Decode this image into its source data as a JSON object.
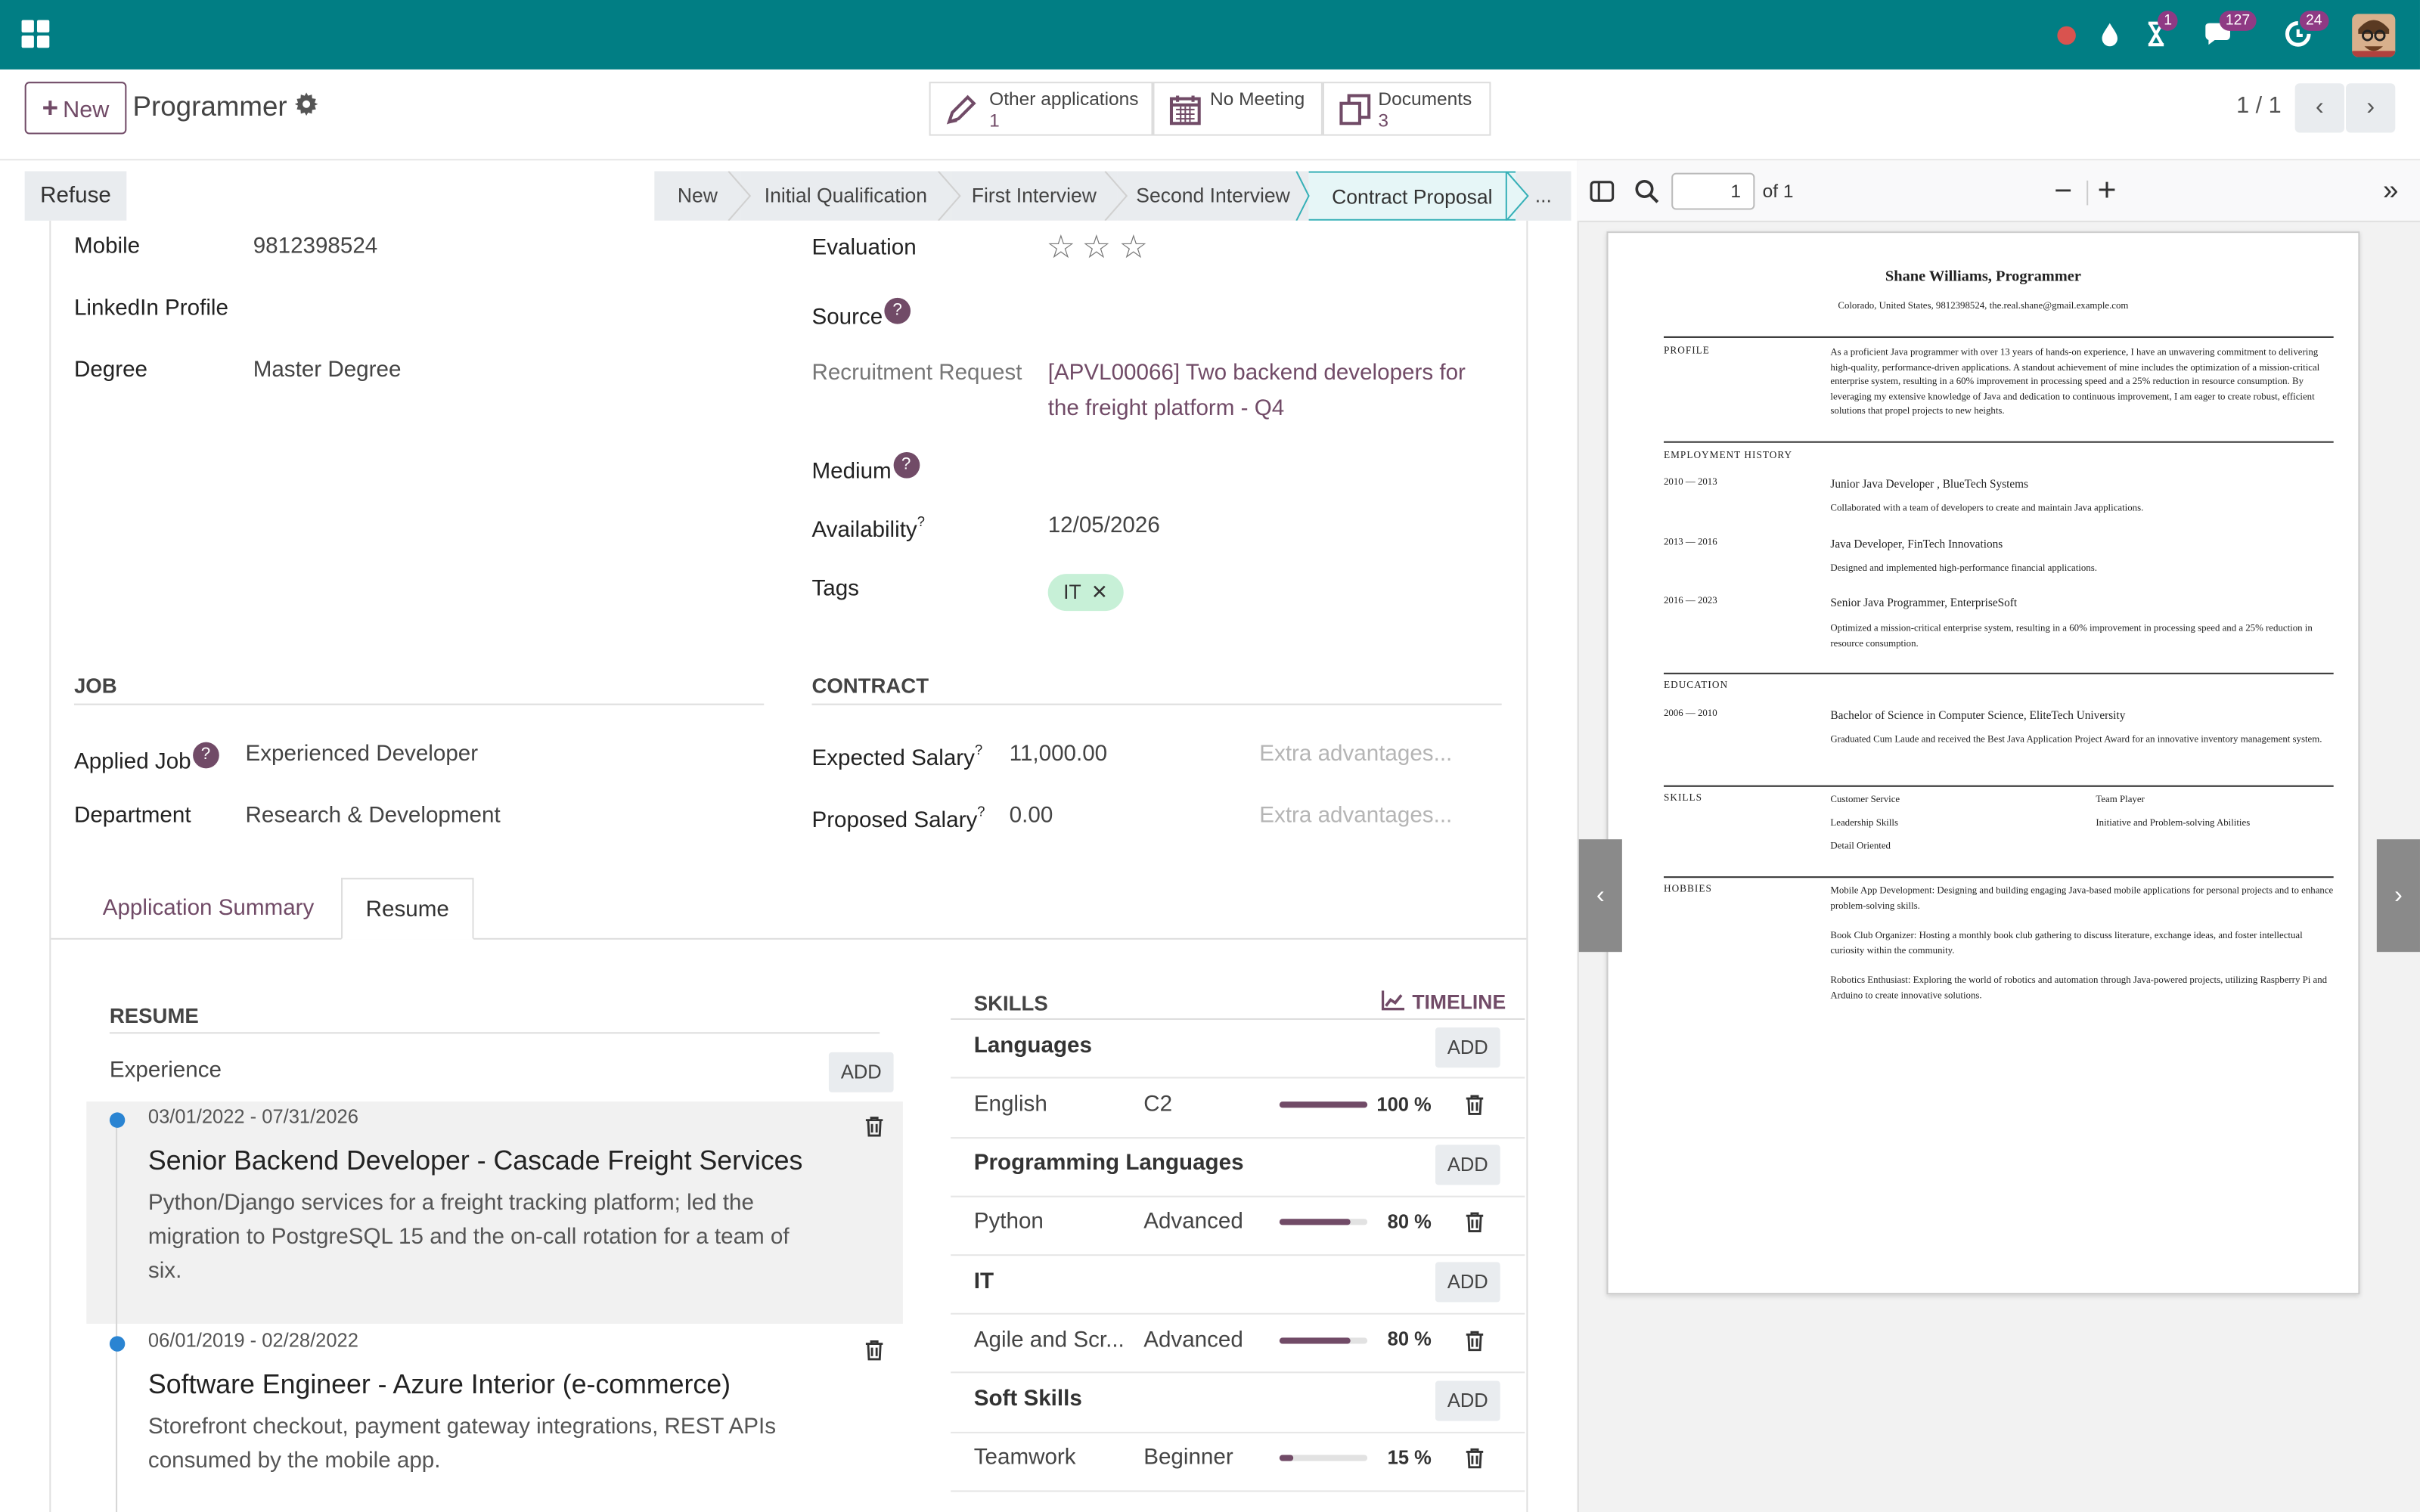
{
  "topbar": {
    "badges": {
      "activity": "1",
      "messages": "127",
      "updates": "24"
    },
    "accent_color": "#017e84",
    "brand_color": "#714b67"
  },
  "control": {
    "new_label": "New",
    "title": "Programmer",
    "smart_buttons": [
      {
        "label": "Other applications",
        "count": "1"
      },
      {
        "label": "No Meeting",
        "count": ""
      },
      {
        "label": "Documents",
        "count": "3"
      }
    ],
    "pager": "1 / 1"
  },
  "statusbar": {
    "refuse_label": "Refuse",
    "stages": [
      "New",
      "Initial Qualification",
      "First Interview",
      "Second Interview",
      "Contract Proposal",
      "..."
    ],
    "active_stage": "Contract Proposal"
  },
  "form": {
    "mobile_label": "Mobile",
    "mobile_value": "9812398524",
    "linkedin_label": "LinkedIn Profile",
    "degree_label": "Degree",
    "degree_value": "Master Degree",
    "evaluation_label": "Evaluation",
    "source_label": "Source",
    "recruitment_label": "Recruitment Request",
    "recruitment_value_1": "[APVL00066] Two backend developers for",
    "recruitment_value_2": "the freight platform - Q4",
    "medium_label": "Medium",
    "availability_label": "Availability",
    "availability_value": "12/05/2026",
    "tags_label": "Tags",
    "tag_value": "IT",
    "job_section": "JOB",
    "contract_section": "CONTRACT",
    "applied_job_label": "Applied Job",
    "applied_job_value": "Experienced Developer",
    "department_label": "Department",
    "department_value": "Research & Development",
    "expected_salary_label": "Expected Salary",
    "expected_salary_value": "11,000.00",
    "proposed_salary_label": "Proposed Salary",
    "proposed_salary_value": "0.00",
    "extra_placeholder": "Extra advantages..."
  },
  "tabs": [
    "Application Summary",
    "Resume"
  ],
  "resume": {
    "section": "RESUME",
    "experience_label": "Experience",
    "add_label": "ADD",
    "entries": [
      {
        "dates": "03/01/2022 - 07/31/2026",
        "title": "Senior Backend Developer - Cascade Freight Services",
        "desc": [
          "Python/Django services for a freight tracking platform; led the",
          "migration to PostgreSQL 15 and the on-call rotation for a team of",
          "six."
        ]
      },
      {
        "dates": "06/01/2019 - 02/28/2022",
        "title": "Software Engineer - Azure Interior (e-commerce)",
        "desc": [
          "Storefront checkout, payment gateway integrations, REST APIs",
          "consumed by the mobile app."
        ]
      }
    ]
  },
  "skills": {
    "section": "SKILLS",
    "timeline_label": "TIMELINE",
    "add_label": "ADD",
    "groups": [
      {
        "name": "Languages",
        "skill": "English",
        "level": "C2",
        "progress": 100,
        "progress_label": "100 %"
      },
      {
        "name": "Programming Languages",
        "skill": "Python",
        "level": "Advanced",
        "progress": 80,
        "progress_label": "80 %"
      },
      {
        "name": "IT",
        "skill": "Agile and Scr...",
        "level": "Advanced",
        "progress": 80,
        "progress_label": "80 %"
      },
      {
        "name": "Soft Skills",
        "skill": "Teamwork",
        "level": "Beginner",
        "progress": 15,
        "progress_label": "15 %"
      }
    ]
  },
  "pdf": {
    "page_value": "1",
    "page_total": "of 1",
    "cv": {
      "name": "Shane Williams, Programmer",
      "contact": "Colorado, United States, 9812398524, the.real.shane@gmail.example.com",
      "profile_label": "PROFILE",
      "profile_text": "As a proficient Java programmer with over 13 years of hands-on experience, I have an unwavering commitment to delivering high-quality, performance-driven applications. A standout achievement of mine includes the optimization of a mission-critical enterprise system, resulting in a 60% improvement in processing speed and a 25% reduction in resource consumption. By leveraging my extensive knowledge of Java and dedication to continuous improvement, I am eager to create robust, efficient solutions that propel projects to new heights.",
      "employment_label": "EMPLOYMENT HISTORY",
      "jobs": [
        {
          "years": "2010 — 2013",
          "title": "Junior Java Developer , BlueTech Systems",
          "desc": "Collaborated with a team of developers to create and maintain Java applications."
        },
        {
          "years": "2013 — 2016",
          "title": "Java Developer, FinTech Innovations",
          "desc": "Designed and implemented high-performance financial applications."
        },
        {
          "years": "2016 — 2023",
          "title": "Senior Java Programmer, EnterpriseSoft",
          "desc": "Optimized a mission-critical enterprise system, resulting in a 60% improvement in processing speed and a 25% reduction in resource consumption."
        }
      ],
      "education_label": "EDUCATION",
      "edu_years": "2006 — 2010",
      "edu_title": "Bachelor of Science in Computer Science, EliteTech University",
      "edu_desc": "Graduated Cum Laude and received the Best Java Application Project Award for an innovative inventory management system.",
      "skills_label": "SKILLS",
      "cv_skills": [
        "Customer Service",
        "Team Player",
        "Leadership Skills",
        "Initiative and Problem-solving Abilities",
        "Detail Oriented"
      ],
      "hobbies_label": "HOBBIES",
      "hobbies": [
        "Mobile App Development: Designing and building engaging Java-based mobile applications for personal projects and to enhance problem-solving skills.",
        "Book Club Organizer: Hosting a monthly book club gathering to discuss literature, exchange ideas, and foster intellectual curiosity within the community.",
        "Robotics Enthusiast: Exploring the world of robotics and automation through Java-powered projects, utilizing Raspberry Pi and Arduino to create innovative solutions."
      ]
    }
  }
}
